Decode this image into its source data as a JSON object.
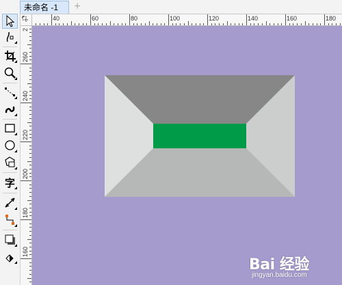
{
  "document": {
    "tab_title": "未命名 -1",
    "add_tab_label": "+"
  },
  "toolbox": {
    "tools": [
      {
        "name": "pick-tool",
        "icon": "pointer-icon"
      },
      {
        "name": "shape-tool",
        "icon": "shape-edit-icon"
      },
      {
        "name": "crop-tool",
        "icon": "crop-icon"
      },
      {
        "name": "zoom-tool",
        "icon": "magnifier-icon"
      },
      {
        "name": "freehand-tool",
        "icon": "freehand-line-icon"
      },
      {
        "name": "artistic-media-tool",
        "icon": "artistic-media-icon"
      },
      {
        "name": "rectangle-tool",
        "icon": "rectangle-icon"
      },
      {
        "name": "ellipse-tool",
        "icon": "ellipse-icon"
      },
      {
        "name": "polygon-tool",
        "icon": "polygon-icon"
      },
      {
        "name": "text-tool",
        "icon": "text-icon",
        "label": "字"
      },
      {
        "name": "dimension-tool",
        "icon": "dimension-icon"
      },
      {
        "name": "connector-tool",
        "icon": "connector-icon"
      },
      {
        "name": "drop-shadow-tool",
        "icon": "drop-shadow-icon"
      },
      {
        "name": "transparency-tool",
        "icon": "transparency-icon"
      }
    ]
  },
  "rulers": {
    "horizontal_labels": [
      "40",
      "60",
      "80",
      "100",
      "120",
      "140",
      "160",
      "180"
    ],
    "vertical_labels": [
      "260",
      "240",
      "220",
      "200",
      "180",
      "160"
    ],
    "vertical_top_label": "2"
  },
  "canvas": {
    "background_color": "#a59bcd",
    "shape": {
      "top_face_color": "#878787",
      "left_face_color": "#dedfdf",
      "right_face_color": "#cbcecc",
      "bottom_face_color": "#b5b8b6",
      "center_rect_color": "#009b48"
    }
  },
  "watermark": {
    "logo_text": "Bai 经验",
    "url_text": "jingyan.baidu.com"
  }
}
